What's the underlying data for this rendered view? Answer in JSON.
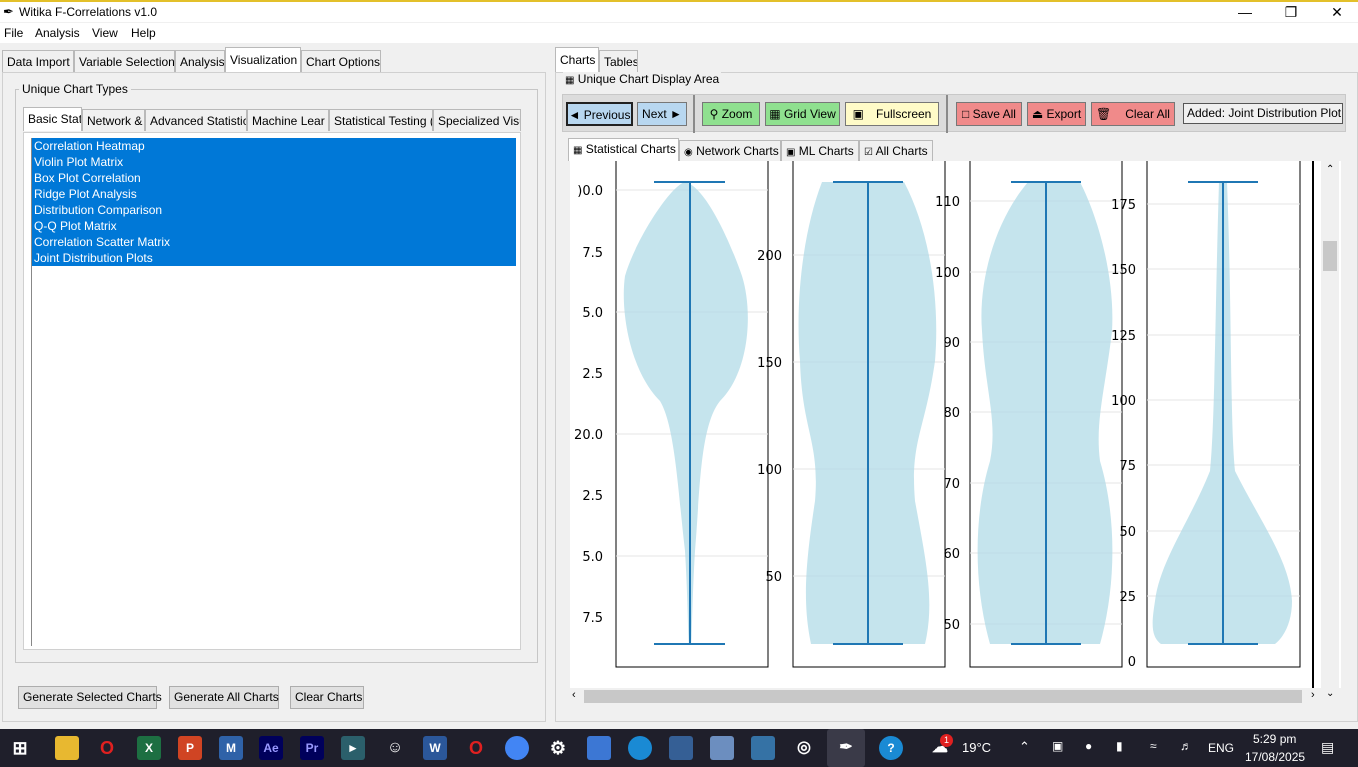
{
  "window": {
    "title": "Witika F-Correlations v1.0",
    "app_icon": "feather-icon"
  },
  "menu": [
    "File",
    "Analysis",
    "View",
    "Help"
  ],
  "left_tabs": [
    "Data Import",
    "Variable Selection",
    "Analysis",
    "Visualization",
    "Chart Options"
  ],
  "group_label": "Unique Chart Types",
  "chart_type_tabs": [
    "Basic Stati",
    "Network &",
    "Advanced Statistic",
    "Machine Lear",
    "Statistical Testing (",
    "Specialized Visu"
  ],
  "chart_types": [
    "Correlation Heatmap",
    "Violin Plot Matrix",
    "Box Plot Correlation",
    "Ridge Plot Analysis",
    "Distribution Comparison",
    "Q-Q Plot Matrix",
    "Correlation Scatter Matrix",
    "Joint Distribution Plots"
  ],
  "buttons": {
    "generate_selected": "Generate Selected Charts",
    "generate_all": "Generate All Charts",
    "clear": "Clear Charts"
  },
  "right_tabs": [
    "Charts",
    "Tables"
  ],
  "display_area_label": "Unique Chart Display Area",
  "toolbar": {
    "previous": "◄ Previous",
    "next": "Next ►",
    "zoom": "Zoom",
    "grid_view": "Grid View",
    "fullscreen": "Fullscreen",
    "save_all": "Save All",
    "export": "Export",
    "clear_all": "Clear All",
    "status": "Added: Joint Distribution Plot"
  },
  "chart_tabs": [
    "Statistical Charts",
    "Network Charts",
    "ML Charts",
    "All Charts"
  ],
  "chart_data": {
    "type": "violin",
    "panels": [
      {
        "yticks": [
          ")0.0",
          "7.5",
          "5.0",
          "2.5",
          "20.0",
          "2.5",
          "5.0",
          "7.5"
        ]
      },
      {
        "yticks": [
          "200",
          "150",
          "100",
          "50"
        ]
      },
      {
        "yticks": [
          "110",
          "100",
          "90",
          "80",
          "70",
          "60",
          "50"
        ]
      },
      {
        "yticks": [
          "175",
          "150",
          "125",
          "100",
          "75",
          "50",
          "25",
          "0"
        ]
      }
    ]
  },
  "taskbar": {
    "weather": "19°C",
    "language": "ENG",
    "time": "5:29 pm",
    "date": "17/08/2025",
    "weather_badge": "1"
  }
}
